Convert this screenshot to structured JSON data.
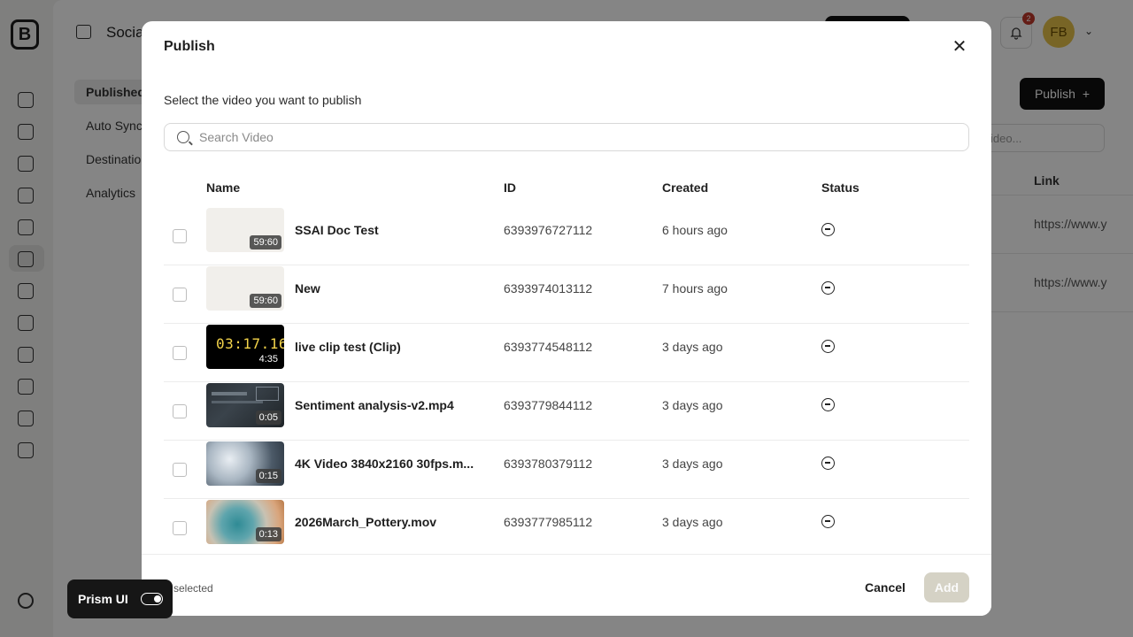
{
  "app": {
    "title": "Socia",
    "nav": [
      "Published",
      "Auto Sync",
      "Destination",
      "Analytics"
    ],
    "publish_label": "Publish",
    "plus_icon": "+",
    "search_placeholder": "ideo...",
    "link_header": "Link",
    "links": [
      "https://www.y",
      "https://www.y"
    ],
    "notification_count": "2",
    "avatar_initials": "FB",
    "caret": "⌄"
  },
  "modal": {
    "title": "Publish",
    "close_glyph": "✕",
    "subtitle": "Select the video you want to publish",
    "search_placeholder": "Search Video",
    "columns": {
      "name": "Name",
      "id": "ID",
      "created": "Created",
      "status": "Status"
    },
    "rows": [
      {
        "name": "SSAI Doc Test",
        "id": "6393976727112",
        "created": "6 hours ago",
        "duration": "59:60",
        "thumb": "blank"
      },
      {
        "name": "New",
        "id": "6393974013112",
        "created": "7 hours ago",
        "duration": "59:60",
        "thumb": "blank"
      },
      {
        "name": "live clip test (Clip)",
        "id": "6393774548112",
        "created": "3 days ago",
        "duration": "4:35",
        "thumb": "clock",
        "thumb_text": "03:17.16"
      },
      {
        "name": "Sentiment analysis-v2.mp4",
        "id": "6393779844112",
        "created": "3 days ago",
        "duration": "0:05",
        "thumb": "screen"
      },
      {
        "name": "4K Video 3840x2160 30fps.m...",
        "id": "6393780379112",
        "created": "3 days ago",
        "duration": "0:15",
        "thumb": "smoke"
      },
      {
        "name": "2026March_Pottery.mov",
        "id": "6393777985112",
        "created": "3 days ago",
        "duration": "0:13",
        "thumb": "pottery"
      }
    ],
    "status_icon": "minus-circle-icon",
    "footer": {
      "selected_text": "selected",
      "cancel_label": "Cancel",
      "add_label": "Add"
    }
  },
  "prism": {
    "label": "Prism UI"
  },
  "colors": {
    "primary_dark": "#111111",
    "add_disabled": "#d5d2c5",
    "badge_red": "#c0392b",
    "avatar_yellow": "#e6c24a"
  }
}
